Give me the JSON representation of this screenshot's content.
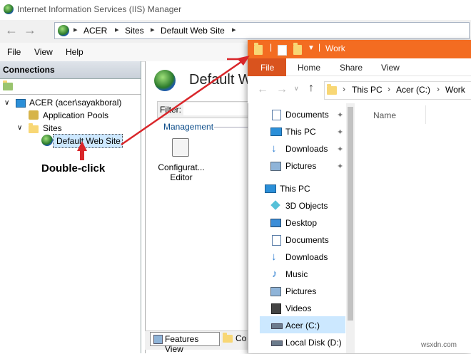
{
  "iis": {
    "window_title": "Internet Information Services (IIS) Manager",
    "breadcrumb": [
      "ACER",
      "Sites",
      "Default Web Site"
    ],
    "menu": [
      "File",
      "View",
      "Help"
    ],
    "connections_header": "Connections",
    "tree": {
      "server": "ACER (acer\\sayakboral)",
      "app_pools": "Application Pools",
      "sites": "Sites",
      "default_site": "Default Web Site"
    },
    "annotation": "Double-click",
    "main_title": "Default W",
    "filter_label": "Filter:",
    "management_label": "Management",
    "feature_label": "Configurat... Editor",
    "bottom_tabs": [
      "Features View",
      "Co"
    ]
  },
  "explorer": {
    "window_title": "Work",
    "ribbon_tabs": [
      "File",
      "Home",
      "Share",
      "View"
    ],
    "breadcrumb": [
      "This PC",
      "Acer (C:)",
      "Work"
    ],
    "quick_access": [
      {
        "label": "Documents",
        "icon": "documents-icon"
      },
      {
        "label": "This PC",
        "icon": "monitor-icon"
      },
      {
        "label": "Downloads",
        "icon": "download-icon"
      },
      {
        "label": "Pictures",
        "icon": "pictures-icon"
      }
    ],
    "this_pc": "This PC",
    "pc_items": [
      "3D Objects",
      "Desktop",
      "Documents",
      "Downloads",
      "Music",
      "Pictures",
      "Videos",
      "Acer (C:)",
      "Local Disk (D:)"
    ],
    "column_name": "Name",
    "accent": "#f36c21"
  },
  "watermark": "wsxdn.com"
}
